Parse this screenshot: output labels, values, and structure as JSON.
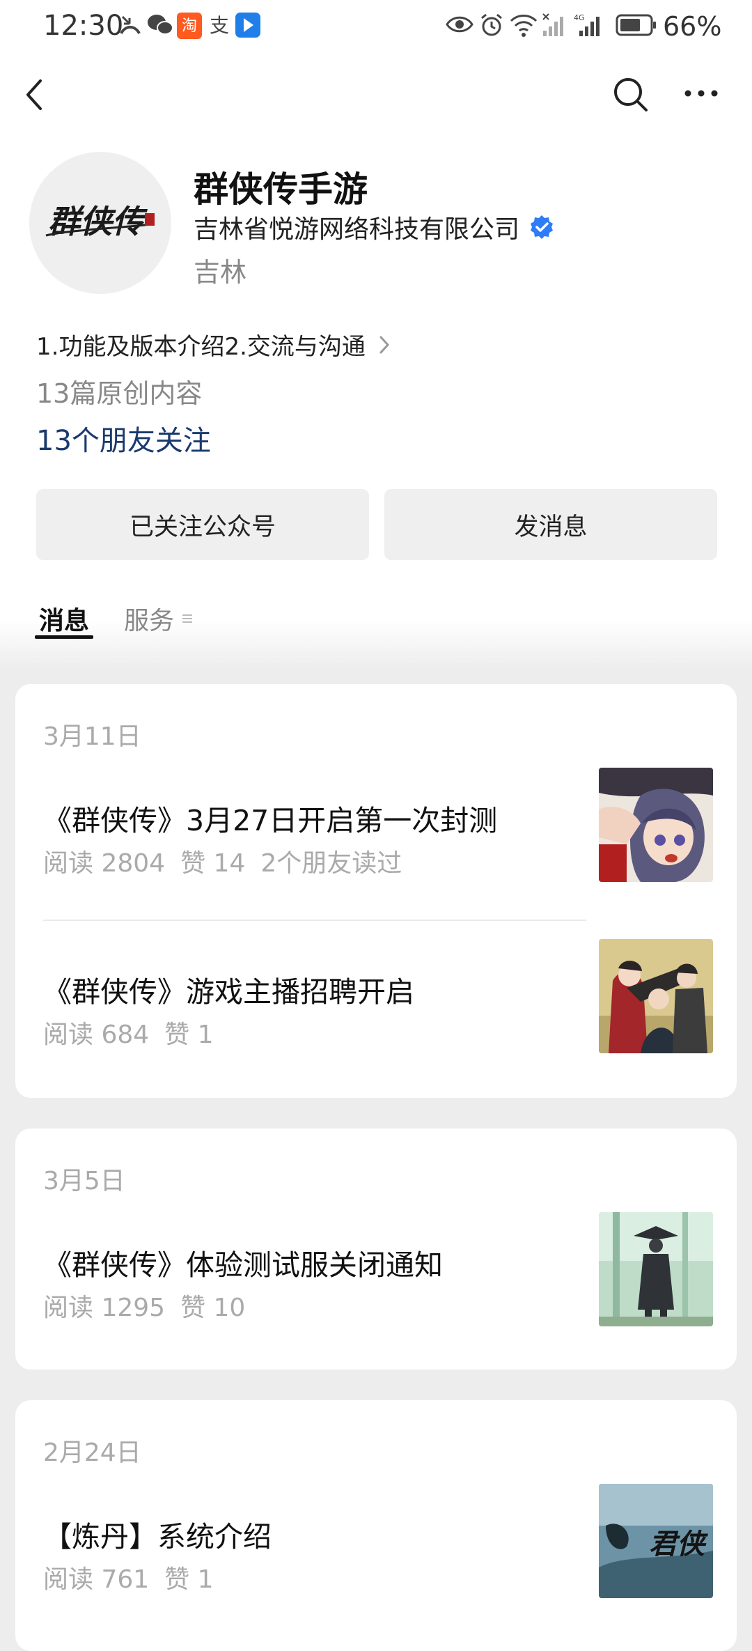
{
  "status_bar": {
    "time": "12:30",
    "battery": "66%",
    "network": "4G",
    "icons_left": [
      "missed-call-icon",
      "wechat-icon",
      "taobao-icon",
      "alipay-icon",
      "app-icon"
    ],
    "icons_right": [
      "eye-icon",
      "alarm-icon",
      "wifi-icon",
      "signal-icon",
      "signal-icon",
      "battery-icon"
    ]
  },
  "nav": {
    "back_icon": "chevron-left-icon",
    "search_icon": "search-icon",
    "more_icon": "more-dots-icon"
  },
  "profile": {
    "name": "群侠传手游",
    "company": "吉林省悦游网络科技有限公司",
    "region": "吉林",
    "avatar_logo_text": "群侠传",
    "intro": "1.功能及版本介绍2.交流与沟通",
    "original_count": "13篇原创内容",
    "friends_follow": "13个朋友关注"
  },
  "actions": {
    "followed_label": "已关注公众号",
    "message_label": "发消息"
  },
  "tabs": {
    "messages": "消息",
    "services": "服务"
  },
  "colors": {
    "link_blue": "#1a3a6e",
    "verified_blue": "#2e7cf6",
    "muted_gray": "#aaaaaa"
  },
  "feed": [
    {
      "date": "3月11日",
      "articles": [
        {
          "title": "《群侠传》3月27日开启第一次封测",
          "reads": "阅读 2804",
          "likes": "赞 14",
          "friends": "2个朋友读过"
        },
        {
          "title": "《群侠传》游戏主播招聘开启",
          "reads": "阅读 684",
          "likes": "赞 1"
        }
      ]
    },
    {
      "date": "3月5日",
      "articles": [
        {
          "title": "《群侠传》体验测试服关闭通知",
          "reads": "阅读 1295",
          "likes": "赞 10"
        }
      ]
    },
    {
      "date": "2月24日",
      "articles": [
        {
          "title": "【炼丹】系统介绍",
          "reads": "阅读 761",
          "likes": "赞 1",
          "thumb_text": "君侠"
        }
      ]
    }
  ]
}
